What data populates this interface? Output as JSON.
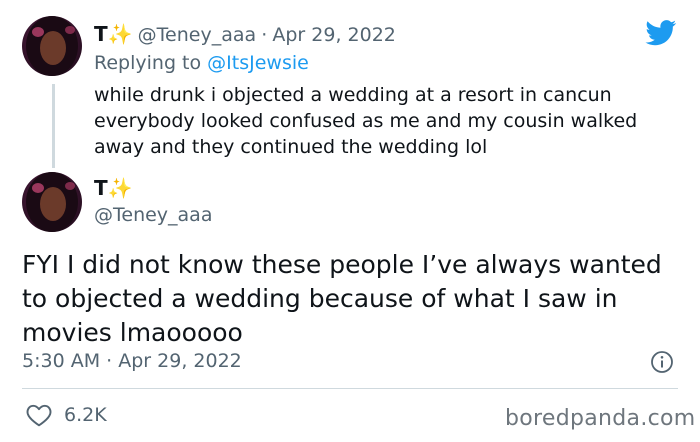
{
  "reply_tweet": {
    "display_name": "T",
    "name_emoji": "✨",
    "handle": "@Teney_aaa",
    "separator": "·",
    "date": "Apr 29, 2022",
    "replying_to_label": "Replying to",
    "replying_to_handle": "@ItsJewsie",
    "text": "while drunk i objected a wedding at a resort in cancun everybody looked confused as me and my cousin walked away and they continued the wedding lol"
  },
  "main_tweet": {
    "display_name": "T",
    "name_emoji": "✨",
    "handle": "@Teney_aaa",
    "text": "FYI I did not know these people I’ve always wanted to objected a wedding because of what I saw in movies lmaooooo",
    "time": "5:30 AM",
    "separator": "·",
    "date": "Apr 29, 2022",
    "likes": "6.2K"
  },
  "watermark": "boredpanda.com",
  "icons": {
    "brand": "twitter-bird-icon",
    "info": "info-icon",
    "like": "heart-icon"
  },
  "colors": {
    "twitter_blue": "#1d9bf0",
    "text_primary": "#0f1419",
    "text_secondary": "#536471",
    "divider": "#cfd9de",
    "sparkle": "#f5b50a"
  }
}
